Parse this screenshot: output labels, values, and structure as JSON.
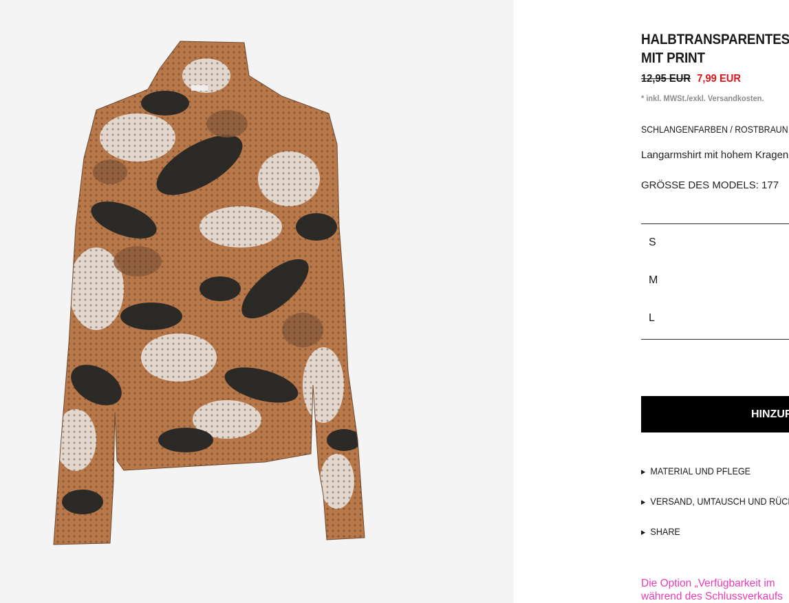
{
  "product": {
    "title_line1": "HALBTRANSPARENTES",
    "title_line2": "MIT PRINT",
    "old_price": "12,95 EUR",
    "new_price": "7,99 EUR",
    "tax_note": "* inkl. MWSt./exkl. Versandkosten.",
    "color": "SCHLANGENFARBEN / ROSTBRAUN",
    "description": "Langarmshirt mit hohem Kragen",
    "model_size": "GRÖSSE DES MODELS: 177"
  },
  "sizes": [
    "S",
    "M",
    "L"
  ],
  "add_button_label": "HINZUFÜGEN",
  "accordions": [
    "MATERIAL UND PFLEGE",
    "VERSAND, UMTAUSCH UND RÜCKGABE",
    "SHARE"
  ],
  "notice_line1": "Die Option „Verfügbarkeit im",
  "notice_line2": "während des Schlussverkaufs",
  "colors": {
    "price_sale": "#e0151b",
    "notice": "#e83cb6",
    "button_bg": "#000000"
  }
}
